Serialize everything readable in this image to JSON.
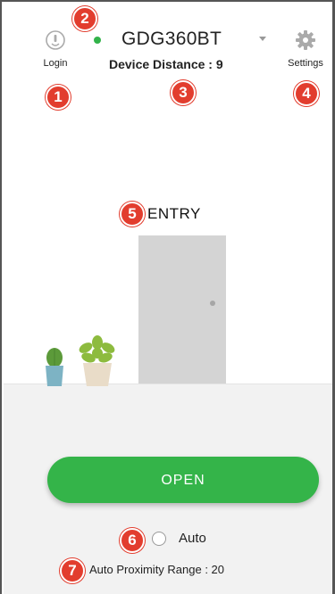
{
  "header": {
    "login_label": "Login",
    "settings_label": "Settings",
    "device_name": "GDG360BT",
    "device_distance": "Device Distance : 9",
    "status_color": "#32b34a"
  },
  "scene": {
    "entry_label": "ENTRY"
  },
  "controls": {
    "open_label": "OPEN",
    "auto_label": "Auto",
    "auto_checked": false,
    "range_text": "Auto Proximity Range : 20",
    "accent_color": "#34b449"
  },
  "callouts": {
    "c1": "1",
    "c2": "2",
    "c3": "3",
    "c4": "4",
    "c5": "5",
    "c6": "6",
    "c7": "7"
  },
  "icons": {
    "login": "login-icon",
    "settings": "gear-icon",
    "dropdown": "chevron-down-icon"
  }
}
